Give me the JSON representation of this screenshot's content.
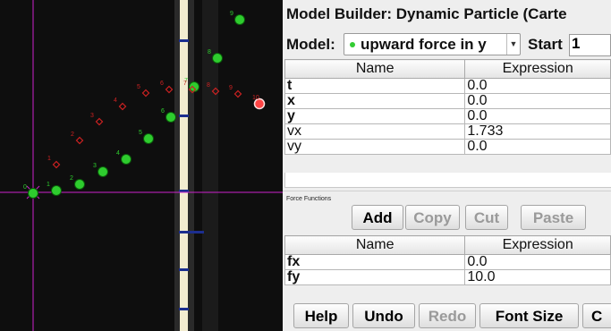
{
  "video": {
    "track_labels": [
      "0",
      "1",
      "2",
      "3",
      "4",
      "5",
      "6",
      "7",
      "8",
      "9",
      "10"
    ],
    "force_labels": [
      "1",
      "2",
      "3",
      "4",
      "5",
      "6",
      "7",
      "8",
      "9",
      "10"
    ],
    "colors": {
      "axis": "#cc22cc",
      "track": "#2ecc2e",
      "model_track": "#cc2222",
      "selected": "#ff4444"
    }
  },
  "panel": {
    "title": "Model Builder: Dynamic Particle (Carte",
    "model_label": "Model:",
    "model_value": "upward force in y",
    "start_label": "Start",
    "start_value": "1",
    "params": {
      "headers": [
        "Name",
        "Expression"
      ],
      "rows": [
        {
          "name": "t",
          "expr": "0.0"
        },
        {
          "name": "x",
          "expr": "0.0"
        },
        {
          "name": "y",
          "expr": "0.0"
        },
        {
          "name": "vx",
          "expr": "1.733"
        },
        {
          "name": "vy",
          "expr": "0.0"
        }
      ]
    },
    "force_section_label": "Force Functions",
    "edit_buttons": [
      "Add",
      "Copy",
      "Cut",
      "Paste"
    ],
    "forces": {
      "headers": [
        "Name",
        "Expression"
      ],
      "rows": [
        {
          "name": "fx",
          "expr": "0.0"
        },
        {
          "name": "fy",
          "expr": "10.0"
        }
      ]
    },
    "bottom_buttons": [
      "Help",
      "Undo",
      "Redo",
      "Font Size",
      "C"
    ]
  }
}
